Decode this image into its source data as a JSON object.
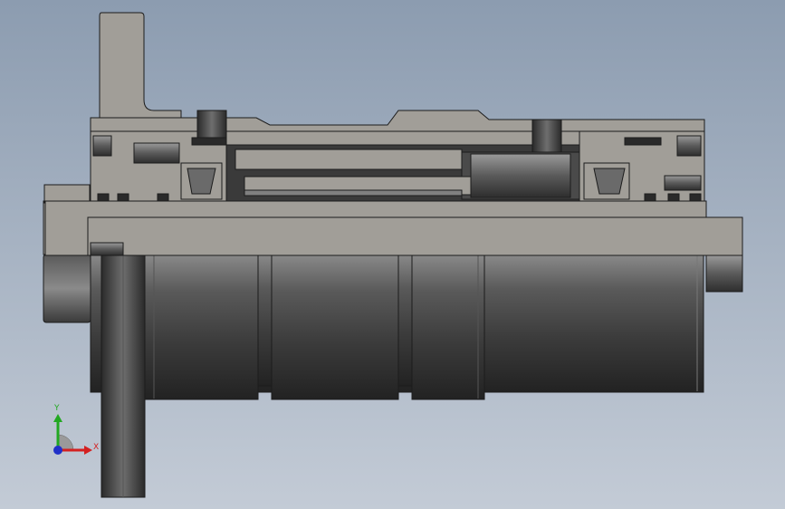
{
  "viewport": {
    "background_top": "#8c9cb0",
    "background_bottom": "#c3cbd6"
  },
  "model": {
    "section_color": "#a19e98",
    "dark_part_color": "#3a3a3a",
    "edge_color": "#1c1c1c"
  },
  "triad": {
    "x_label": "X",
    "y_label": "Y",
    "x_color": "#d42020",
    "y_color": "#22a822",
    "z_color": "#2030c8"
  }
}
